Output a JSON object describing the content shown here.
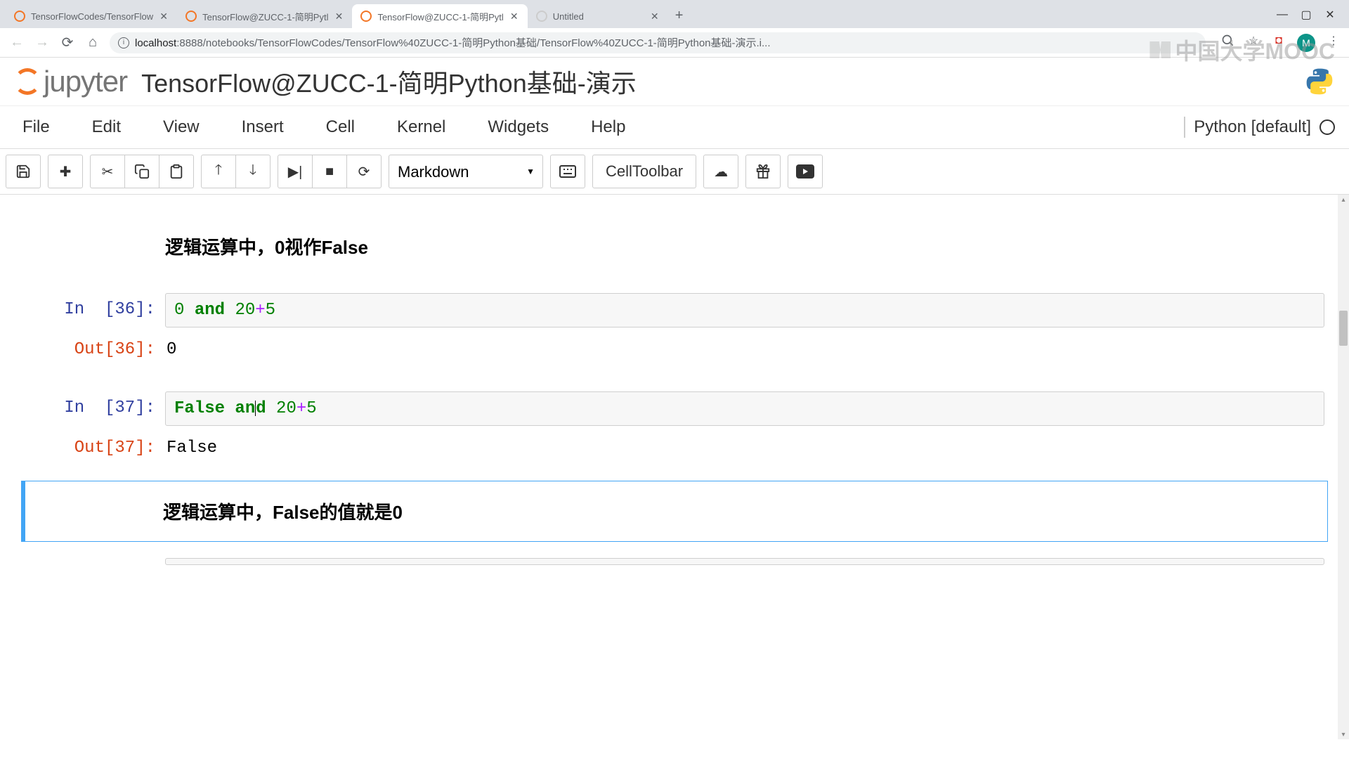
{
  "browser": {
    "tabs": [
      {
        "title": "TensorFlowCodes/TensorFlow",
        "active": false
      },
      {
        "title": "TensorFlow@ZUCC-1-简明Pytl",
        "active": false
      },
      {
        "title": "TensorFlow@ZUCC-1-简明Pytl",
        "active": true
      },
      {
        "title": "Untitled",
        "active": false
      }
    ],
    "url_domain": "localhost",
    "url_port": ":8888",
    "url_path": "/notebooks/TensorFlowCodes/TensorFlow%40ZUCC-1-简明Python基础/TensorFlow%40ZUCC-1-简明Python基础-演示.i...",
    "avatar": "M"
  },
  "watermark": "中国大学MOOC",
  "jupyter": {
    "logo_text": "jupyter",
    "notebook_title": "TensorFlow@ZUCC-1-简明Python基础-演示"
  },
  "menu": {
    "file": "File",
    "edit": "Edit",
    "view": "View",
    "insert": "Insert",
    "cell": "Cell",
    "kernel": "Kernel",
    "widgets": "Widgets",
    "help": "Help",
    "kernel_name": "Python [default]"
  },
  "toolbar": {
    "cell_type": "Markdown",
    "celltoolbar_label": "CellToolbar"
  },
  "cells": {
    "md1": "逻辑运算中，0视作False",
    "in36_num": "36",
    "in36_code_a": "0",
    "in36_code_kw": "and",
    "in36_code_b": "20",
    "in36_code_op": "+",
    "in36_code_c": "5",
    "out36_num": "36",
    "out36_val": "0",
    "in37_num": "37",
    "in37_code_a": "False",
    "in37_code_kw": "and",
    "in37_code_b": "20",
    "in37_code_op": "+",
    "in37_code_c": "5",
    "out37_num": "37",
    "out37_val": "False",
    "md2": "逻辑运算中，False的值就是0"
  }
}
